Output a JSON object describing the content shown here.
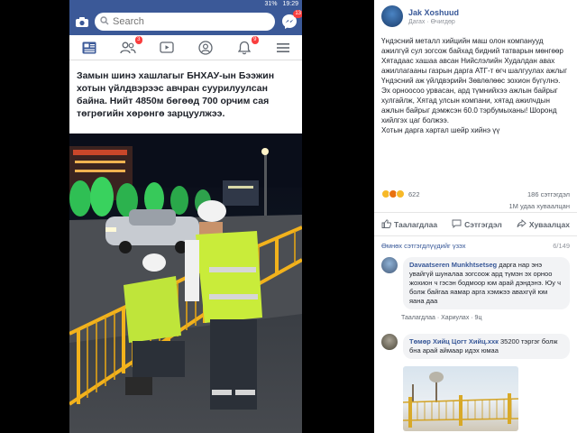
{
  "status_bar": {
    "battery": "31%",
    "time": "19:29"
  },
  "topbar": {
    "search_placeholder": "Search",
    "messenger_badge": "13"
  },
  "nav": {
    "items": [
      {
        "name": "news-feed",
        "badge": ""
      },
      {
        "name": "friends",
        "badge": "3"
      },
      {
        "name": "watch",
        "badge": ""
      },
      {
        "name": "profile",
        "badge": ""
      },
      {
        "name": "notifications",
        "badge": "9"
      },
      {
        "name": "menu",
        "badge": ""
      }
    ]
  },
  "left_post": {
    "text": "Замын шинэ хашлагыг БНХАУ-ын Бээжин хотын үйлдвэрээс авчран суурилуулсан байна. Нийт 4850м бөгөөд 700 орчим сая төгрөгийн хөрөнгө зарцуулжээ."
  },
  "right_post": {
    "author": "Jak Xoshuud",
    "meta_1": "Дагах",
    "meta_2": "Өчигдөр",
    "body": "Үндэсний металл хийцийн маш олон компанууд ажилгүй сул зогсож байхад бидний татварын мөнгөөр Хятадаас хашаа авсан Нийслэлийн Худалдан авах ажиллагааны газрын дарга АТГ-т өгч шалгуулах ажлыг Үндэсний аж үйлдвэрийн Зөвлөлөөс зохион бүгүлнэ.\nЭх орноосоо урвасан, ард түмнийхээ ажлын байрыг хулгайлж, Хятад улсын компани, хятад ажилчдын ажлын байрыг дэмжсэн 60.0 тэрбумыханы! Шоронд хийлгэх цаг болжээ.\nХотын дарга хартал шейр хийнэ үү",
    "reactions_count": "622",
    "comments_count": "186 сэтгэгдэл",
    "shares_count": "1М удаа хуваалцан",
    "like_label": "Таалагдлаа",
    "comment_label": "Сэтгэгдэл",
    "share_label": "Хуваалцах",
    "previous_comments": "Өмнөх сэтгэгдлүүдийг үзэх",
    "previous_count": "6/149",
    "comments": [
      {
        "name": "Davaatseren Munkhtsetseg",
        "text": "дарга нар энэ увайгүй шуналаа зогсоож ард түмэн эх орноо жохион ч гэсэн бодмоор юм арай дэндэнэ. Юу ч болж байгаа яамар арга хэмжээ авахгүй юм яана даа",
        "actions": "Таалагдлаа · Хариулах · 9ц"
      },
      {
        "name": "Төмөр Хийц Цогт Хийц.ххк",
        "text": "35200 тэргэг болж бна арай аймаар идэх юмаа",
        "actions": ""
      }
    ]
  },
  "colors": {
    "fb_blue": "#3b5998",
    "link_blue": "#385898",
    "badge_red": "#fa3e3e"
  }
}
